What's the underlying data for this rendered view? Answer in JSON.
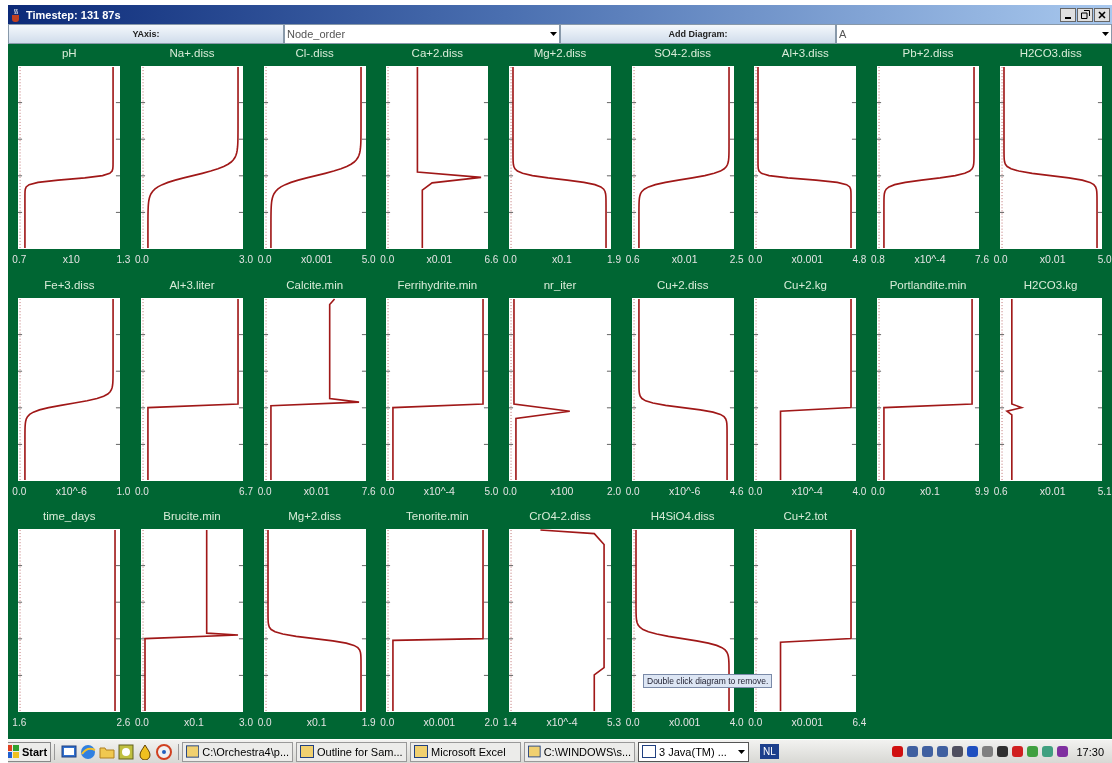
{
  "window": {
    "title": "Timestep: 131 87s"
  },
  "toolbar": {
    "yaxis_button": "YAxis:",
    "yaxis_field": "Node_order",
    "add_button": "Add Diagram:",
    "add_field": "A"
  },
  "diagrams": [
    {
      "title": "pH",
      "min": "0.7",
      "scale": "x10",
      "max": "1.3"
    },
    {
      "title": "Na+.diss",
      "min": "0.0",
      "max": "3.0"
    },
    {
      "title": "Cl-.diss",
      "min": "0.0",
      "scale": "x0.001",
      "max": "5.0"
    },
    {
      "title": "Ca+2.diss",
      "min": "0.0",
      "scale": "x0.01",
      "max": "6.6"
    },
    {
      "title": "Mg+2.diss",
      "min": "0.0",
      "scale": "x0.1",
      "max": "1.9"
    },
    {
      "title": "SO4-2.diss",
      "min": "0.6",
      "scale": "x0.01",
      "max": "2.5"
    },
    {
      "title": "Al+3.diss",
      "min": "0.0",
      "scale": "x0.001",
      "max": "4.8"
    },
    {
      "title": "Pb+2.diss",
      "min": "0.8",
      "scale": "x10^-4",
      "max": "7.6"
    },
    {
      "title": "H2CO3.diss",
      "min": "0.0",
      "scale": "x0.01",
      "max": "5.0"
    },
    {
      "title": "Fe+3.diss",
      "min": "0.0",
      "scale": "x10^-6",
      "max": "1.0"
    },
    {
      "title": "Al+3.liter",
      "min": "0.0",
      "max": "6.7"
    },
    {
      "title": "Calcite.min",
      "min": "0.0",
      "scale": "x0.01",
      "max": "7.6"
    },
    {
      "title": "Ferrihydrite.min",
      "min": "0.0",
      "scale": "x10^-4",
      "max": "5.0"
    },
    {
      "title": "nr_iter",
      "min": "0.0",
      "scale": "x100",
      "max": "2.0"
    },
    {
      "title": "Cu+2.diss",
      "min": "0.0",
      "scale": "x10^-6",
      "max": "4.6"
    },
    {
      "title": "Cu+2.kg",
      "min": "0.0",
      "scale": "x10^-4",
      "max": "4.0"
    },
    {
      "title": "Portlandite.min",
      "min": "0.0",
      "scale": "x0.1",
      "max": "9.9"
    },
    {
      "title": "H2CO3.kg",
      "min": "0.6",
      "scale": "x0.01",
      "max": "5.1"
    },
    {
      "title": "time_days",
      "min": "1.6",
      "max": "2.6"
    },
    {
      "title": "Brucite.min",
      "min": "0.0",
      "scale": "x0.1",
      "max": "3.0"
    },
    {
      "title": "Mg+2.diss",
      "min": "0.0",
      "scale": "x0.1",
      "max": "1.9"
    },
    {
      "title": "Tenorite.min",
      "min": "0.0",
      "scale": "x0.001",
      "max": "2.0"
    },
    {
      "title": "CrO4-2.diss",
      "min": "1.4",
      "scale": "x10^-4",
      "max": "5.3"
    },
    {
      "title": "H4SiO4.diss",
      "min": "0.0",
      "scale": "x0.001",
      "max": "4.0"
    },
    {
      "title": "Cu+2.tot",
      "min": "0.0",
      "scale": "x0.001",
      "max": "6.4"
    }
  ],
  "tooltip": "Double click diagram to remove.",
  "taskbar": {
    "start": "Start",
    "tasks": [
      {
        "label": "C:\\Orchestra4\\p...",
        "selected": false
      },
      {
        "label": "Outline for Sam...",
        "selected": false
      },
      {
        "label": "Microsoft Excel",
        "selected": false
      },
      {
        "label": "C:\\WINDOWS\\s...",
        "selected": false
      },
      {
        "label": "3 Java(TM) ...",
        "selected": true
      }
    ],
    "language": "NL",
    "clock": "17:30"
  }
}
